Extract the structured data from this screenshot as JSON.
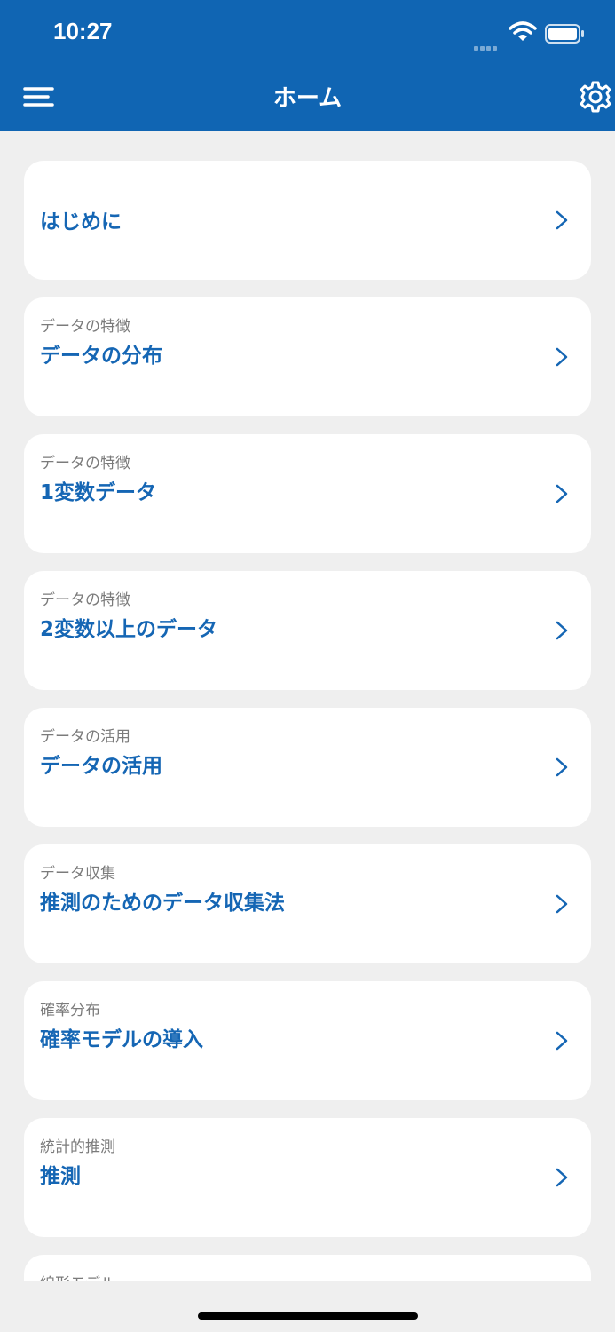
{
  "status_bar": {
    "time": "10:27"
  },
  "header": {
    "title": "ホーム"
  },
  "cards": [
    {
      "category": "",
      "title": "はじめに"
    },
    {
      "category": "データの特徴",
      "title": "データの分布"
    },
    {
      "category": "データの特徴",
      "title": "1変数データ"
    },
    {
      "category": "データの特徴",
      "title": "2変数以上のデータ"
    },
    {
      "category": "データの活用",
      "title": "データの活用"
    },
    {
      "category": "データ収集",
      "title": "推測のためのデータ収集法"
    },
    {
      "category": "確率分布",
      "title": "確率モデルの導入"
    },
    {
      "category": "統計的推測",
      "title": "推測"
    },
    {
      "category": "線形モデル",
      "title": ""
    }
  ],
  "colors": {
    "header_bg": "#1065b3",
    "accent": "#1566b4",
    "page_bg": "#efefef"
  },
  "icons": {
    "menu": "hamburger-menu-icon",
    "settings": "gear-icon",
    "chevron": "chevron-right-icon",
    "wifi": "wifi-icon",
    "battery": "battery-icon"
  }
}
